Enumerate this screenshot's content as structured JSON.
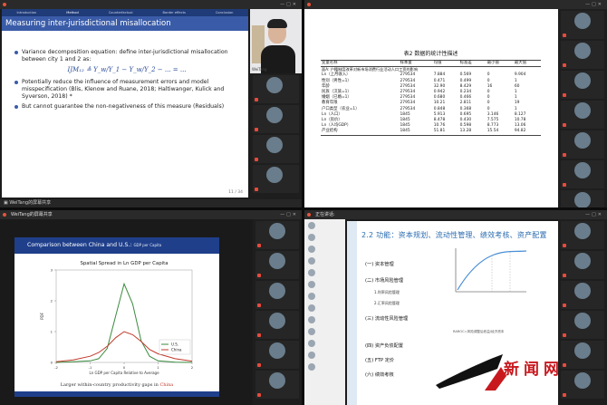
{
  "colors": {
    "beamer_blue": "#3a5ca8",
    "beamer_nav": "#1f3b78",
    "accent_blue": "#2b6cb0",
    "china_red": "#c0392b",
    "us_green": "#3b8a3e",
    "watermark_red": "#c8181e",
    "meeting_dark": "#1b1b1b"
  },
  "icons": [
    "mic-muted-icon",
    "avatar-icon",
    "window-close-icon",
    "share-screen-icon"
  ],
  "tl": {
    "titlebar": "",
    "share_label": "WeiTang的屏幕共享",
    "nav": [
      "Introduction",
      "Method",
      "Counterfactual",
      "Border effects",
      "Conclusion"
    ],
    "nav_active": 1,
    "slide_title": "Measuring inter-jurisdictional misallocation",
    "bullet1": "Variance decomposition equation: define inter-jurisdictional misallocation between city 1 and 2 as:",
    "equation": "IJM₁₂ ≜ Y_w/Y_1 − Y_w/Y_2 − ... = ...",
    "bullet2": "Potentially reduce the influence of measurement errors and model misspecification (Blis, Klenow and Ruane, 2018; Haltiwanger, Kulick and Syverson, 2018) *",
    "bullet3": "But cannot guarantee the non-negativeness of this measure (Residuals)",
    "page": "11 / 34",
    "video_name": "WeiTang"
  },
  "tr": {
    "titlebar": "",
    "table": {
      "title": "表2  数据的统计性描述",
      "headers": [
        "变量名称",
        "样本量",
        "均值",
        "标准差",
        "最小值",
        "最大值"
      ],
      "group": "面A: 户籍制度改革对新市场消费行业活动人口工资的影响",
      "rows": [
        [
          "Ln（上月收入）",
          "279534",
          "7.884",
          "0.569",
          "0",
          "9.904"
        ],
        [
          "性别（男性=1）",
          "279534",
          "0.471",
          "0.499",
          "0",
          "1"
        ],
        [
          "年龄",
          "279534",
          "32.90",
          "8.429",
          "16",
          "60"
        ],
        [
          "民族（汉族=1）",
          "279534",
          "0.942",
          "0.234",
          "0",
          "1"
        ],
        [
          "婚姻（已婚=1）",
          "279534",
          "0.680",
          "0.466",
          "0",
          "1"
        ],
        [
          "教育年限",
          "279534",
          "10.21",
          "2.811",
          "0",
          "19"
        ],
        [
          "户口类型（农业=1）",
          "279534",
          "0.848",
          "0.368",
          "0",
          "1"
        ],
        [
          "Ln（人口）",
          "1845",
          "5.913",
          "0.695",
          "3.146",
          "8.127"
        ],
        [
          "Ln（房价）",
          "1845",
          "8.478",
          "0.430",
          "7.575",
          "10.78"
        ],
        [
          "Ln（人均GDP）",
          "1845",
          "10.76",
          "0.598",
          "8.773",
          "13.06"
        ],
        [
          "产业结构",
          "1845",
          "51.81",
          "13.28",
          "15.54",
          "94.82"
        ]
      ]
    }
  },
  "bl": {
    "titlebar": "WeiTang的屏幕共享",
    "slide_title": "Comparison between China and U.S.:",
    "slide_subtitle": "GDP per Capita",
    "caption_pre": "Larger within-country productivity gaps in ",
    "caption_highlight": "China",
    "footer": "",
    "chart_data": {
      "type": "line",
      "title": "Spatial Spread in Ln GDP per Capita",
      "xlabel": "Ln GDP per Capita Relative to Average",
      "ylabel": "PDF",
      "xlim": [
        -2,
        2
      ],
      "ylim": [
        0,
        3
      ],
      "x": [
        -2.0,
        -1.5,
        -1.0,
        -0.75,
        -0.5,
        -0.25,
        0.0,
        0.25,
        0.5,
        0.75,
        1.0,
        1.5,
        2.0
      ],
      "series": [
        {
          "name": "U.S.",
          "color": "#3b8a3e",
          "values": [
            0.0,
            0.02,
            0.05,
            0.12,
            0.45,
            1.5,
            2.55,
            1.9,
            0.7,
            0.2,
            0.05,
            0.01,
            0.0
          ]
        },
        {
          "name": "China",
          "color": "#c0392b",
          "values": [
            0.02,
            0.08,
            0.2,
            0.32,
            0.52,
            0.8,
            1.0,
            0.9,
            0.68,
            0.42,
            0.28,
            0.12,
            0.04
          ]
        }
      ],
      "xticks": [
        "-2",
        "-1",
        "0",
        "1",
        "2"
      ],
      "yticks": [
        "0",
        "1",
        "2",
        "3"
      ],
      "legend": "bottom-right"
    }
  },
  "br": {
    "titlebar": "正在讲话:",
    "slide_title": "2.2 功能：资本规划、流动性管理、绩效考核、资产配置",
    "items": [
      "(一) 资本管理",
      "(二) 市场风险管理",
      "(三) 流动性风险管理",
      "(四) 资产负债配置",
      "(五) FTP 定价",
      "(六) 绩效考核"
    ],
    "subitems": [
      "1.利率风险管理",
      "2.汇率风险管理"
    ],
    "notes": [
      "RAROC=风险调整后收益/经济资本"
    ],
    "watermark": "新闻网"
  }
}
